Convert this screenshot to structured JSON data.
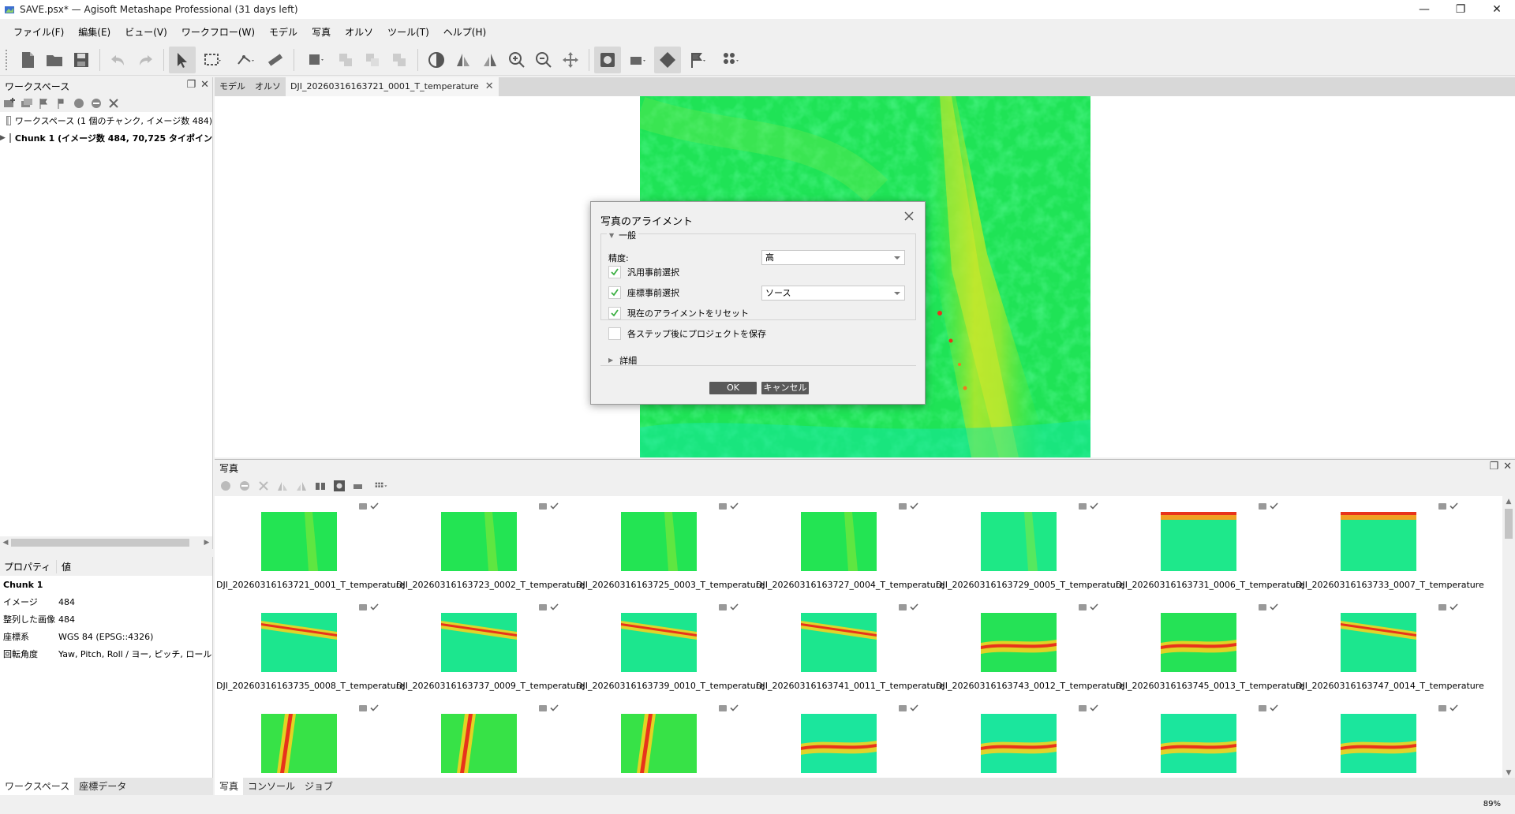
{
  "window": {
    "title": "SAVE.psx* — Agisoft Metashape Professional (31 days left)",
    "minimize": "—",
    "maximize": "❐",
    "close": "✕"
  },
  "menu": [
    "ファイル(F)",
    "編集(E)",
    "ビュー(V)",
    "ワークフロー(W)",
    "モデル",
    "写真",
    "オルソ",
    "ツール(T)",
    "ヘルプ(H)"
  ],
  "workspace": {
    "title": "ワークスペース",
    "root_label": "ワークスペース (1 個のチャンク, イメージ数 484)",
    "chunk_label": "Chunk 1 (イメージ数 484, 70,725 タイポイント)"
  },
  "properties": {
    "col_property": "プロパティ",
    "col_value": "値",
    "group": "Chunk 1",
    "rows": [
      {
        "key": "イメージ",
        "value": "484"
      },
      {
        "key": "整列した画像",
        "value": "484"
      },
      {
        "key": "座標系",
        "value": "WGS 84 (EPSG::4326)"
      },
      {
        "key": "回転角度",
        "value": "Yaw, Pitch, Roll / ヨー, ピッチ, ロール"
      }
    ]
  },
  "left_tabs": [
    "ワークスペース",
    "座標データ"
  ],
  "doc_tabs": [
    "モデル",
    "オルソ",
    "DJI_20260316163721_0001_T_temperature"
  ],
  "dialog": {
    "title": "写真のアライメント",
    "general": "一般",
    "accuracy_label": "精度:",
    "accuracy_value": "高",
    "generic_preselection": "汎用事前選択",
    "reference_preselection": "座標事前選択",
    "reference_value": "ソース",
    "reset_alignment": "現在のアライメントをリセット",
    "save_each_step": "各ステップ後にプロジェクトを保存",
    "advanced": "詳細",
    "ok": "OK",
    "cancel": "キャンセル",
    "checks": [
      true,
      true,
      true,
      false
    ]
  },
  "photos": {
    "title": "写真",
    "items": [
      {
        "name": "DJI_20260316163721_0001_T_temperature",
        "style": "a"
      },
      {
        "name": "DJI_20260316163723_0002_T_temperature",
        "style": "a"
      },
      {
        "name": "DJI_20260316163725_0003_T_temperature",
        "style": "a"
      },
      {
        "name": "DJI_20260316163727_0004_T_temperature",
        "style": "a"
      },
      {
        "name": "DJI_20260316163729_0005_T_temperature",
        "style": "b"
      },
      {
        "name": "DJI_20260316163731_0006_T_temperature",
        "style": "c"
      },
      {
        "name": "DJI_20260316163733_0007_T_temperature",
        "style": "c"
      },
      {
        "name": "DJI_20260316163735_0008_T_temperature",
        "style": "d"
      },
      {
        "name": "DJI_20260316163737_0009_T_temperature",
        "style": "d"
      },
      {
        "name": "DJI_20260316163739_0010_T_temperature",
        "style": "d"
      },
      {
        "name": "DJI_20260316163741_0011_T_temperature",
        "style": "d"
      },
      {
        "name": "DJI_20260316163743_0012_T_temperature",
        "style": "e"
      },
      {
        "name": "DJI_20260316163745_0013_T_temperature",
        "style": "e"
      },
      {
        "name": "DJI_20260316163747_0014_T_temperature",
        "style": "d"
      },
      {
        "name": "",
        "style": "f"
      },
      {
        "name": "",
        "style": "f"
      },
      {
        "name": "",
        "style": "f"
      },
      {
        "name": "",
        "style": "g"
      },
      {
        "name": "",
        "style": "g"
      },
      {
        "name": "",
        "style": "g"
      },
      {
        "name": "",
        "style": "g"
      }
    ]
  },
  "bottom_tabs": [
    "写真",
    "コンソール",
    "ジョブ"
  ],
  "status": {
    "zoom": "89%"
  },
  "colors": {
    "accent_check": "#3cb043",
    "thermal_green": "#22e84a",
    "thermal_cyan": "#12e8b8",
    "thermal_red": "#e8331b"
  }
}
